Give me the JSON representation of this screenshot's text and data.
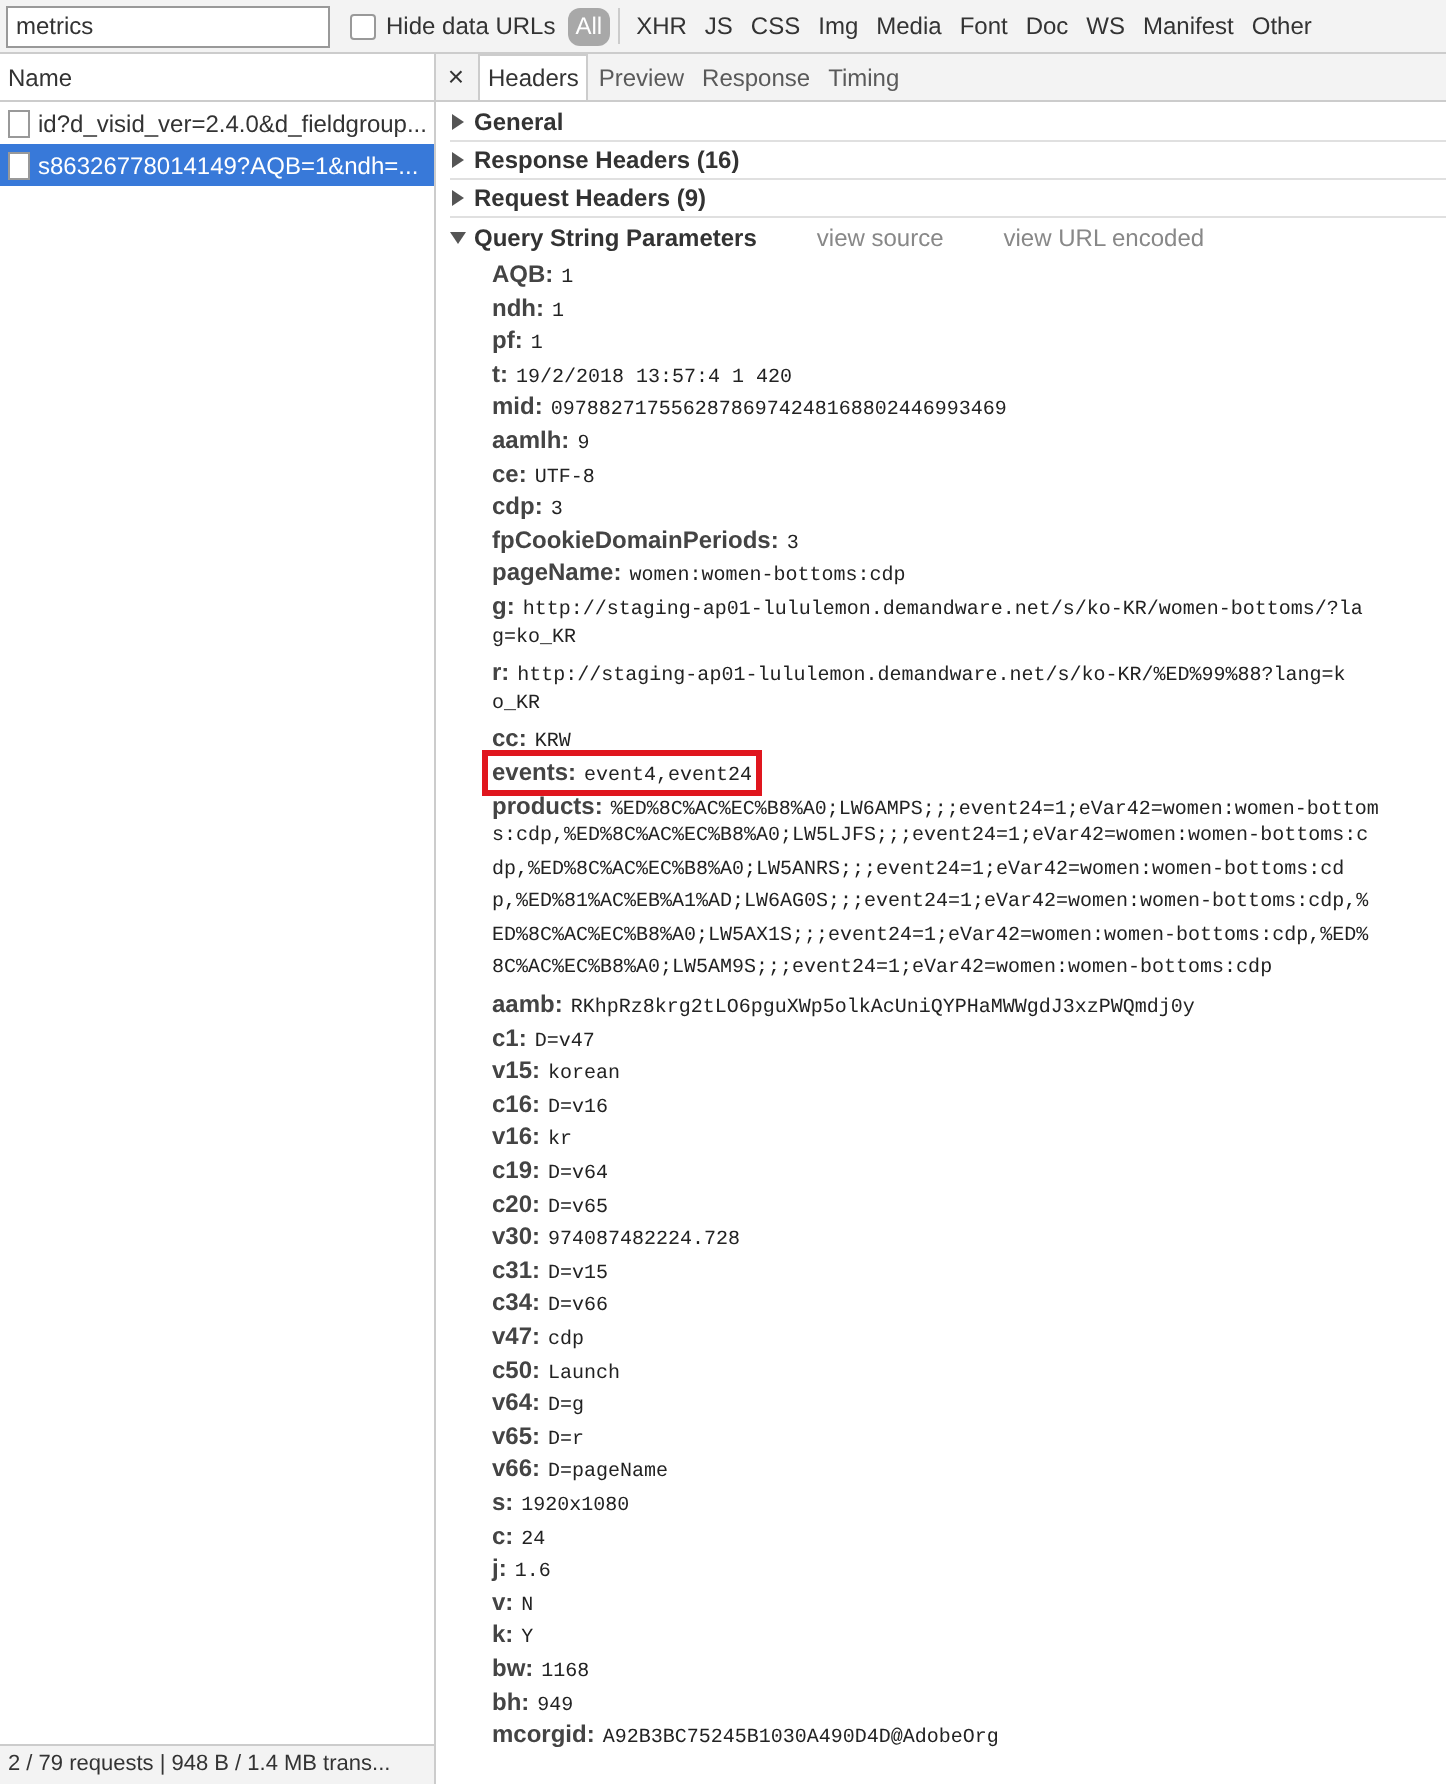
{
  "filter_bar": {
    "search": {
      "value": "metrics"
    },
    "hide_data_urls": {
      "label": "Hide data URLs",
      "checked": false
    },
    "types": [
      {
        "label": "All",
        "selected": true
      },
      {
        "label": "XHR",
        "selected": false
      },
      {
        "label": "JS",
        "selected": false
      },
      {
        "label": "CSS",
        "selected": false
      },
      {
        "label": "Img",
        "selected": false
      },
      {
        "label": "Media",
        "selected": false
      },
      {
        "label": "Font",
        "selected": false
      },
      {
        "label": "Doc",
        "selected": false
      },
      {
        "label": "WS",
        "selected": false
      },
      {
        "label": "Manifest",
        "selected": false
      },
      {
        "label": "Other",
        "selected": false
      }
    ]
  },
  "requests": {
    "column": "Name",
    "rows": [
      {
        "name": "id?d_visid_ver=2.4.0&d_fieldgroup...",
        "selected": false
      },
      {
        "name": "s86326778014149?AQB=1&ndh=...",
        "selected": true
      }
    ],
    "status_bar": "2 / 79 requests | 948 B / 1.4 MB trans..."
  },
  "details": {
    "close": "×",
    "tabs": [
      {
        "label": "Headers",
        "selected": true
      },
      {
        "label": "Preview",
        "selected": false
      },
      {
        "label": "Response",
        "selected": false
      },
      {
        "label": "Timing",
        "selected": false
      }
    ],
    "sections": [
      {
        "title": "General",
        "expanded": false
      },
      {
        "title": "Response Headers (16)",
        "expanded": false
      },
      {
        "title": "Request Headers (9)",
        "expanded": false
      }
    ],
    "query": {
      "title": "Query String Parameters",
      "expanded": true,
      "links": [
        "view source",
        "view URL encoded"
      ],
      "params": [
        {
          "key": "AQB:",
          "lines": [
            "1"
          ],
          "highlighted": false
        },
        {
          "key": "ndh:",
          "lines": [
            "1"
          ],
          "highlighted": false
        },
        {
          "key": "pf:",
          "lines": [
            "1"
          ],
          "highlighted": false
        },
        {
          "key": "t:",
          "lines": [
            "19/2/2018 13:57:4 1 420"
          ],
          "highlighted": false
        },
        {
          "key": "mid:",
          "lines": [
            "09788271755628786974248168802446993469"
          ],
          "highlighted": false
        },
        {
          "key": "aamlh:",
          "lines": [
            "9"
          ],
          "highlighted": false
        },
        {
          "key": "ce:",
          "lines": [
            "UTF-8"
          ],
          "highlighted": false
        },
        {
          "key": "cdp:",
          "lines": [
            "3"
          ],
          "highlighted": false
        },
        {
          "key": "fpCookieDomainPeriods:",
          "lines": [
            "3"
          ],
          "highlighted": false
        },
        {
          "key": "pageName:",
          "lines": [
            "women:women-bottoms:cdp"
          ],
          "highlighted": false
        },
        {
          "key": "g:",
          "lines": [
            "http://staging-ap01-lululemon.demandware.net/s/ko-KR/women-bottoms/?la",
            "g=ko_KR"
          ],
          "highlighted": false
        },
        {
          "key": "r:",
          "lines": [
            "http://staging-ap01-lululemon.demandware.net/s/ko-KR/%ED%99%88?lang=k",
            "o_KR"
          ],
          "highlighted": false
        },
        {
          "key": "cc:",
          "lines": [
            "KRW"
          ],
          "highlighted": false
        },
        {
          "key": "events:",
          "lines": [
            "event4,event24"
          ],
          "highlighted": true
        },
        {
          "key": "products:",
          "lines": [
            "%ED%8C%AC%EC%B8%A0;LW6AMPS;;;event24=1;eVar42=women:women-bottom",
            "s:cdp,%ED%8C%AC%EC%B8%A0;LW5LJFS;;;event24=1;eVar42=women:women-bottoms:c",
            "dp,%ED%8C%AC%EC%B8%A0;LW5ANRS;;;event24=1;eVar42=women:women-bottoms:cd",
            "p,%ED%81%AC%EB%A1%AD;LW6AG0S;;;event24=1;eVar42=women:women-bottoms:cdp,%",
            "ED%8C%AC%EC%B8%A0;LW5AX1S;;;event24=1;eVar42=women:women-bottoms:cdp,%ED%",
            "8C%AC%EC%B8%A0;LW5AM9S;;;event24=1;eVar42=women:women-bottoms:cdp"
          ],
          "highlighted": false
        },
        {
          "key": "aamb:",
          "lines": [
            "RKhpRz8krg2tLO6pguXWp5olkAcUniQYPHaMWWgdJ3xzPWQmdj0y"
          ],
          "highlighted": false
        },
        {
          "key": "c1:",
          "lines": [
            "D=v47"
          ],
          "highlighted": false
        },
        {
          "key": "v15:",
          "lines": [
            "korean"
          ],
          "highlighted": false
        },
        {
          "key": "c16:",
          "lines": [
            "D=v16"
          ],
          "highlighted": false
        },
        {
          "key": "v16:",
          "lines": [
            "kr"
          ],
          "highlighted": false
        },
        {
          "key": "c19:",
          "lines": [
            "D=v64"
          ],
          "highlighted": false
        },
        {
          "key": "c20:",
          "lines": [
            "D=v65"
          ],
          "highlighted": false
        },
        {
          "key": "v30:",
          "lines": [
            "974087482224.728"
          ],
          "highlighted": false
        },
        {
          "key": "c31:",
          "lines": [
            "D=v15"
          ],
          "highlighted": false
        },
        {
          "key": "c34:",
          "lines": [
            "D=v66"
          ],
          "highlighted": false
        },
        {
          "key": "v47:",
          "lines": [
            "cdp"
          ],
          "highlighted": false
        },
        {
          "key": "c50:",
          "lines": [
            "Launch"
          ],
          "highlighted": false
        },
        {
          "key": "v64:",
          "lines": [
            "D=g"
          ],
          "highlighted": false
        },
        {
          "key": "v65:",
          "lines": [
            "D=r"
          ],
          "highlighted": false
        },
        {
          "key": "v66:",
          "lines": [
            "D=pageName"
          ],
          "highlighted": false
        },
        {
          "key": "s:",
          "lines": [
            "1920x1080"
          ],
          "highlighted": false
        },
        {
          "key": "c:",
          "lines": [
            "24"
          ],
          "highlighted": false
        },
        {
          "key": "j:",
          "lines": [
            "1.6"
          ],
          "highlighted": false
        },
        {
          "key": "v:",
          "lines": [
            "N"
          ],
          "highlighted": false
        },
        {
          "key": "k:",
          "lines": [
            "Y"
          ],
          "highlighted": false
        },
        {
          "key": "bw:",
          "lines": [
            "1168"
          ],
          "highlighted": false
        },
        {
          "key": "bh:",
          "lines": [
            "949"
          ],
          "highlighted": false
        },
        {
          "key": "mcorgid:",
          "lines": [
            "A92B3BC75245B1030A490D4D@AdobeOrg"
          ],
          "highlighted": false
        }
      ]
    }
  }
}
